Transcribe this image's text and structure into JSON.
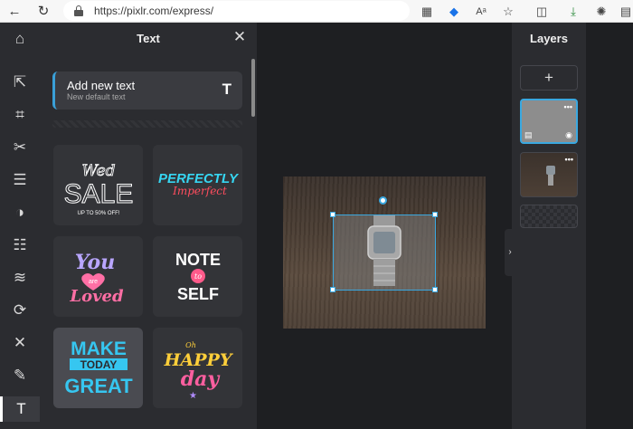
{
  "browser": {
    "url": "https://pixlr.com/express/",
    "back_icon": "back-arrow-icon",
    "refresh_icon": "refresh-icon",
    "read_aloud_label": "Aᵃ"
  },
  "tools": [
    {
      "name": "arrange-icon",
      "glyph": "⇱"
    },
    {
      "name": "crop-icon",
      "glyph": "⌗"
    },
    {
      "name": "cutout-icon",
      "glyph": "✂"
    },
    {
      "name": "adjust-icon",
      "glyph": "☰"
    },
    {
      "name": "filter-icon",
      "glyph": "◑"
    },
    {
      "name": "effect-icon",
      "glyph": "☷"
    },
    {
      "name": "liquify-icon",
      "glyph": "≋"
    },
    {
      "name": "swirl-icon",
      "glyph": "⟳"
    },
    {
      "name": "heal-icon",
      "glyph": "✕"
    },
    {
      "name": "brush-icon",
      "glyph": "✎"
    },
    {
      "name": "text-tool-icon",
      "glyph": "T"
    }
  ],
  "text_panel": {
    "title": "Text",
    "close_glyph": "✕",
    "add_title": "Add new text",
    "add_subtitle": "New default text",
    "add_icon_glyph": "T"
  },
  "text_templates": [
    {
      "id": "wed-sale",
      "lines": [
        "Wed",
        "SALE",
        "UP TO 50% OFF!"
      ],
      "colors": [
        "#ffffff"
      ]
    },
    {
      "id": "perfectly-imperfect",
      "lines": [
        "PERFECTLY",
        "Imperfect"
      ],
      "colors": [
        "#36d6f2",
        "#ff4d5e"
      ]
    },
    {
      "id": "you-are-loved",
      "lines": [
        "You",
        "are",
        "Loved"
      ],
      "colors": [
        "#b9a6ff",
        "#ff6fa5"
      ]
    },
    {
      "id": "note-to-self",
      "lines": [
        "NOTE",
        "to",
        "SELF"
      ],
      "colors": [
        "#ffffff",
        "#ff5a8a"
      ]
    },
    {
      "id": "make-today-great",
      "lines": [
        "MAKE",
        "TODAY",
        "GREAT"
      ],
      "colors": [
        "#36c6f0",
        "#ffffff"
      ]
    },
    {
      "id": "happy-day",
      "lines": [
        "Oh",
        "HAPPY",
        "day"
      ],
      "colors": [
        "#ffcf3a",
        "#ff5fa0",
        "#b08bff"
      ]
    }
  ],
  "layers_panel": {
    "title": "Layers",
    "add_glyph": "+",
    "layer_dots": "•••",
    "eye_glyph": "◉",
    "lock_glyph": "▤"
  },
  "workspace": {
    "collapse_glyph": "›"
  }
}
